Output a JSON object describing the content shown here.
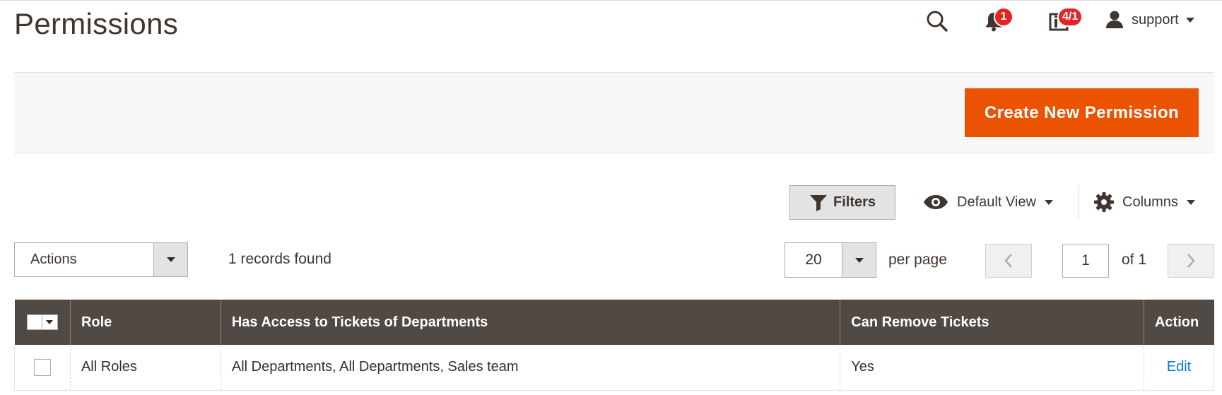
{
  "page": {
    "title": "Permissions"
  },
  "header": {
    "notifications_count": "1",
    "system_messages_count": "4/1",
    "user_name": "support"
  },
  "actions": {
    "create_button": "Create New Permission"
  },
  "toolbar": {
    "filters_label": "Filters",
    "view_label": "Default View",
    "columns_label": "Columns",
    "mass_actions_label": "Actions",
    "records_found": "1 records found",
    "per_page_value": "20",
    "per_page_label": "per page",
    "current_page": "1",
    "of_pages": "of 1"
  },
  "grid": {
    "columns": [
      "Role",
      "Has Access to Tickets of Departments",
      "Can Remove Tickets",
      "Action"
    ],
    "rows": [
      {
        "role": "All Roles",
        "departments": "All Departments, All Departments, Sales team",
        "can_remove": "Yes",
        "action": "Edit"
      }
    ]
  },
  "colors": {
    "accent": "#eb5202",
    "header_bg": "#514943",
    "link": "#007bdb",
    "badge": "#e22626"
  },
  "icons": [
    "search-icon",
    "bell-icon",
    "system-messages-icon",
    "user-icon",
    "filter-icon",
    "eye-icon",
    "gear-icon",
    "chevron-left-icon",
    "chevron-right-icon"
  ]
}
